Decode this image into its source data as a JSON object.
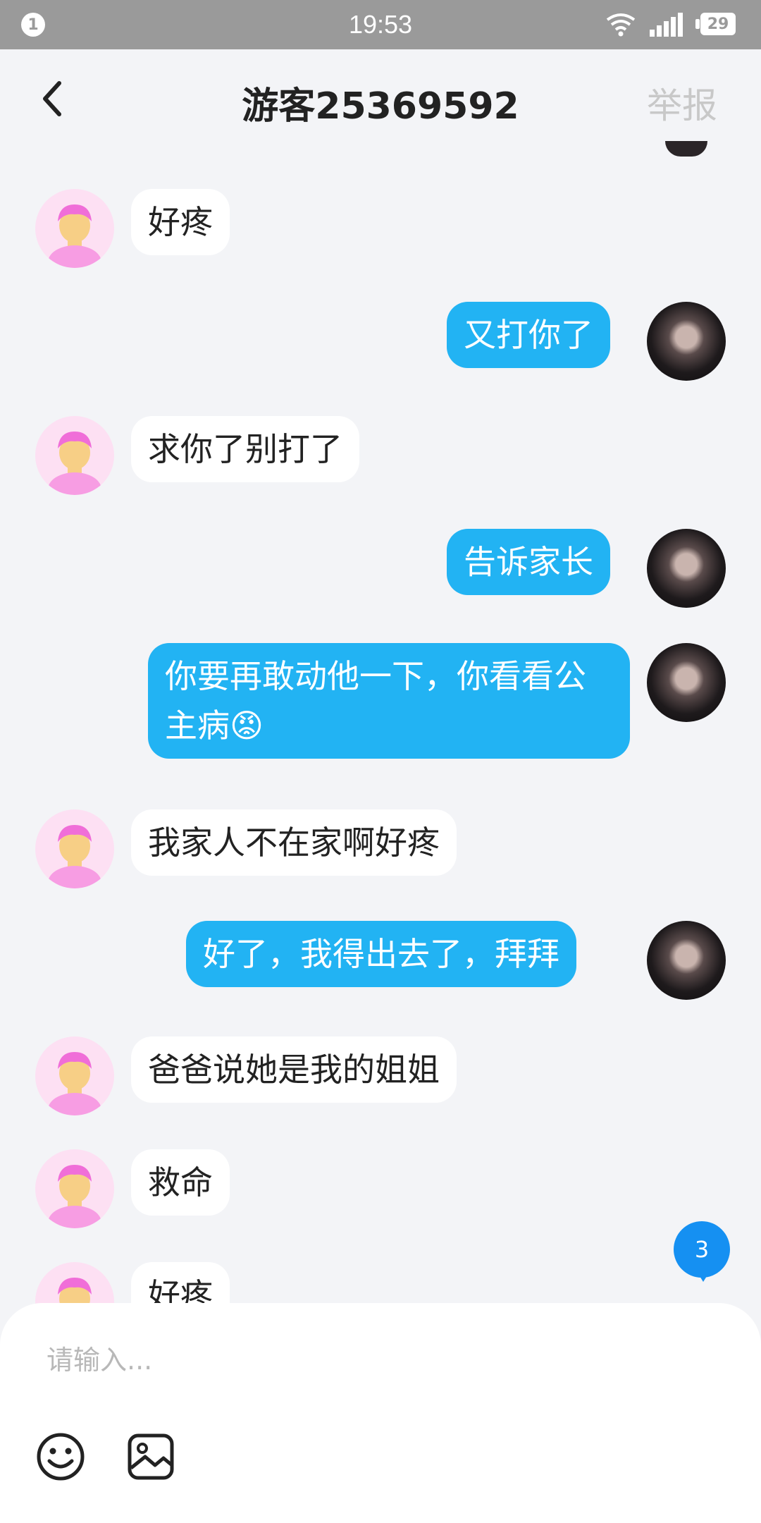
{
  "status_bar": {
    "notification_count": "1",
    "time": "19:53",
    "battery": "29",
    "icons": [
      "wifi-icon",
      "signal-icon",
      "battery-icon"
    ]
  },
  "header": {
    "title": "游客25369592",
    "report_label": "举报",
    "back_icon": "chevron-left-icon"
  },
  "messages": [
    {
      "side": "other",
      "text": "好疼"
    },
    {
      "side": "me",
      "text": "又打你了"
    },
    {
      "side": "other",
      "text": "求你了别打了"
    },
    {
      "side": "me",
      "text": "告诉家长"
    },
    {
      "side": "me",
      "text": "你要再敢动他一下，你看看公主病😡"
    },
    {
      "side": "other",
      "text": "我家人不在家啊好疼"
    },
    {
      "side": "me",
      "text": "好了，我得出去了，拜拜"
    },
    {
      "side": "other",
      "text": "爸爸说她是我的姐姐"
    },
    {
      "side": "other",
      "text": "救命"
    },
    {
      "side": "other",
      "text": "好疼"
    }
  ],
  "unread_count": "3",
  "input": {
    "placeholder": "请输入...",
    "value": "",
    "tools": [
      "smiley-icon",
      "image-icon"
    ]
  },
  "colors": {
    "my_bubble": "#22b3f3",
    "other_bubble": "#ffffff",
    "background": "#f3f4f7",
    "badge": "#1590f2"
  }
}
